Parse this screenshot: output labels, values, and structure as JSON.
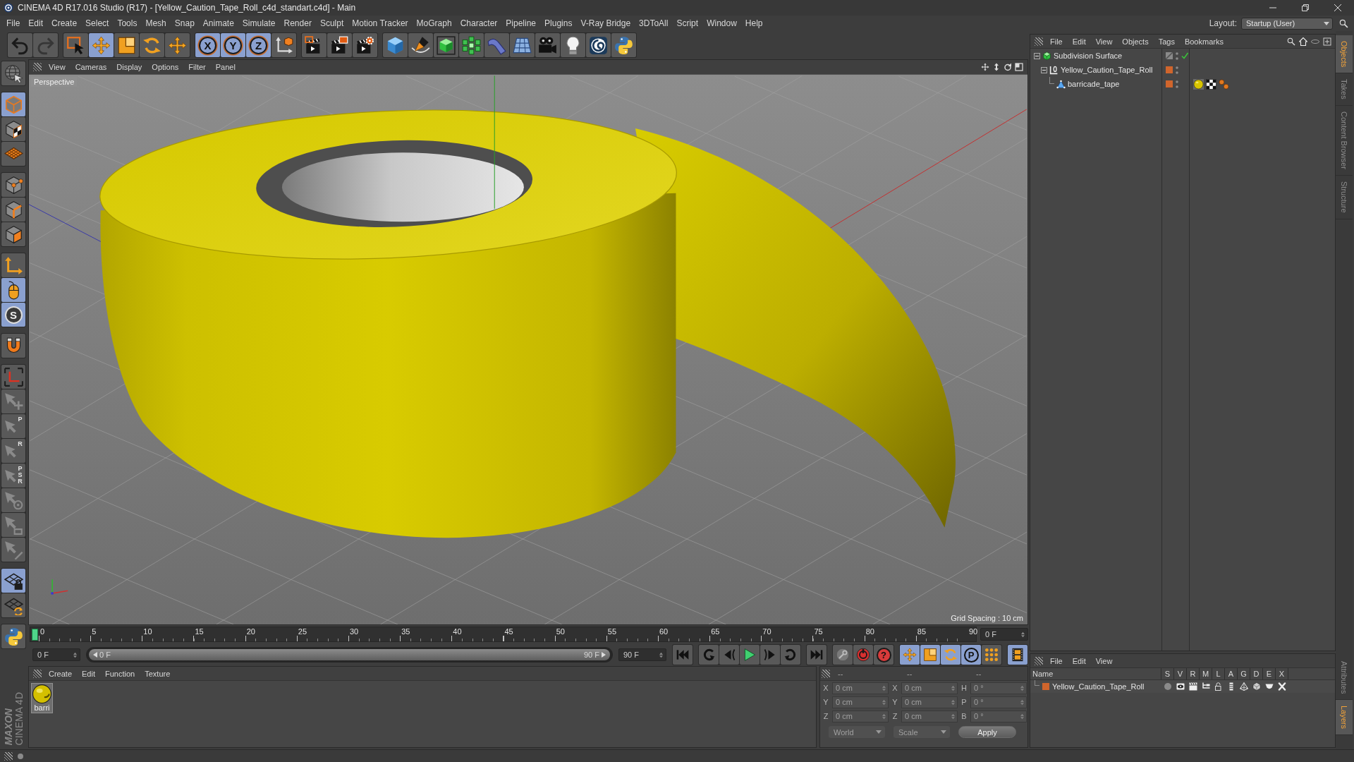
{
  "window": {
    "title": "CINEMA 4D R17.016 Studio (R17) - [Yellow_Caution_Tape_Roll_c4d_standart.c4d] - Main"
  },
  "menu_bar": [
    "File",
    "Edit",
    "Create",
    "Select",
    "Tools",
    "Mesh",
    "Snap",
    "Animate",
    "Simulate",
    "Render",
    "Sculpt",
    "Motion Tracker",
    "MoGraph",
    "Character",
    "Pipeline",
    "Plugins",
    "V-Ray Bridge",
    "3DToAll",
    "Script",
    "Window",
    "Help"
  ],
  "layout": {
    "label": "Layout:",
    "value": "Startup (User)"
  },
  "toolbar": [
    [
      {
        "selected": false,
        "disabled": false
      },
      {
        "selected": false,
        "disabled": true
      }
    ],
    [
      {
        "selected": false,
        "disabled": false
      },
      {
        "selected": true,
        "disabled": false
      },
      {
        "selected": false,
        "disabled": false
      },
      {
        "selected": false,
        "disabled": false
      },
      {
        "selected": false,
        "disabled": false
      }
    ],
    [
      {
        "label": "X",
        "selected": true,
        "disabled": false
      },
      {
        "label": "Y",
        "selected": true,
        "disabled": false
      },
      {
        "label": "Z",
        "selected": true,
        "disabled": false
      },
      {
        "selected": false,
        "disabled": false
      }
    ],
    [
      {
        "selected": false,
        "disabled": false
      },
      {
        "selected": false,
        "disabled": false
      },
      {
        "selected": false,
        "disabled": false
      }
    ],
    [
      {
        "selected": false,
        "disabled": false
      },
      {
        "selected": false,
        "disabled": false
      },
      {
        "selected": false,
        "disabled": false
      },
      {
        "selected": false,
        "disabled": false
      },
      {
        "selected": false,
        "disabled": false
      },
      {
        "selected": false,
        "disabled": false
      },
      {
        "selected": false,
        "disabled": false
      },
      {
        "selected": false,
        "disabled": false
      },
      {
        "selected": false,
        "disabled": false
      },
      {
        "selected": false,
        "disabled": false
      }
    ]
  ],
  "tools": [
    [
      {
        "selected": false,
        "disabled": false
      }
    ],
    [
      {
        "selected": true,
        "disabled": false
      },
      {
        "selected": false,
        "disabled": false
      },
      {
        "selected": false,
        "disabled": false
      }
    ],
    [
      {
        "selected": false,
        "disabled": false
      },
      {
        "selected": false,
        "disabled": false
      },
      {
        "selected": false,
        "disabled": false
      }
    ],
    [
      {
        "selected": false,
        "disabled": false
      },
      {
        "selected": true,
        "disabled": false
      },
      {
        "label": "S",
        "selected": true,
        "disabled": false
      }
    ],
    [
      {
        "selected": false,
        "disabled": false
      }
    ],
    [
      {
        "selected": false,
        "disabled": false
      },
      {
        "selected": false,
        "disabled": true
      },
      {
        "label": "P",
        "selected": false,
        "disabled": true
      },
      {
        "label": "R",
        "selected": false,
        "disabled": true
      },
      {
        "label": "PSR",
        "selected": false,
        "disabled": true
      },
      {
        "selected": false,
        "disabled": true
      },
      {
        "selected": false,
        "disabled": true
      },
      {
        "selected": false,
        "disabled": true
      }
    ],
    [
      {
        "selected": true,
        "disabled": false
      },
      {
        "selected": false,
        "disabled": false
      }
    ],
    [
      {
        "selected": false,
        "disabled": false
      }
    ]
  ],
  "viewport": {
    "menu": [
      "View",
      "Cameras",
      "Display",
      "Options",
      "Filter",
      "Panel"
    ],
    "camera": "Perspective",
    "grid_spacing": "Grid Spacing : 10 cm"
  },
  "timeline": {
    "ticks": [
      "0",
      "5",
      "10",
      "15",
      "20",
      "25",
      "30",
      "35",
      "40",
      "45",
      "50",
      "55",
      "60",
      "65",
      "70",
      "75",
      "80",
      "85",
      "90"
    ],
    "level": 0,
    "frame": "0 F"
  },
  "frame_range": {
    "start": "0 F",
    "slider_start": "0 F",
    "slider_end": "90 F",
    "level": 1,
    "end": "90 F"
  },
  "transport": [
    [
      {
        "selected": false
      }
    ],
    [
      {
        "selected": false
      },
      {
        "selected": false
      },
      {
        "selected": false
      },
      {
        "selected": false
      },
      {
        "selected": false
      }
    ],
    [
      {
        "selected": false
      }
    ],
    [
      {
        "selected": false
      },
      {
        "selected": false
      },
      {
        "label": "?",
        "selected": false
      }
    ],
    [
      {
        "selected": true
      },
      {
        "selected": true
      },
      {
        "selected": true
      },
      {
        "label": "P",
        "selected": true
      },
      {
        "selected": false
      }
    ],
    [
      {
        "selected": true
      }
    ]
  ],
  "materials": {
    "menu": [
      "Create",
      "Edit",
      "Function",
      "Texture"
    ],
    "items": [
      {
        "name": "barri"
      }
    ]
  },
  "coordinates": {
    "headers": [
      "--",
      "--",
      "--"
    ],
    "rows": [
      [
        {
          "axis": "X",
          "value": "0 cm",
          "disabled": true
        },
        {
          "axis": "X",
          "value": "0 cm",
          "disabled": true
        },
        {
          "axis": "H",
          "value": "0 °",
          "disabled": true
        }
      ],
      [
        {
          "axis": "Y",
          "value": "0 cm",
          "disabled": true
        },
        {
          "axis": "Y",
          "value": "0 cm",
          "disabled": true
        },
        {
          "axis": "P",
          "value": "0 °",
          "disabled": true
        }
      ],
      [
        {
          "axis": "Z",
          "value": "0 cm",
          "disabled": true
        },
        {
          "axis": "Z",
          "value": "0 cm",
          "disabled": true
        },
        {
          "axis": "B",
          "value": "0 °",
          "disabled": true
        }
      ]
    ],
    "modes": [
      {
        "label": "World",
        "disabled": true
      },
      {
        "label": "Scale",
        "disabled": true
      }
    ],
    "apply": "Apply"
  },
  "objects": {
    "menu": [
      "File",
      "Edit",
      "View",
      "Objects",
      "Tags",
      "Bookmarks"
    ],
    "tree": [
      {
        "kind": "subdivision",
        "name": "Subdivision Surface",
        "expanded": true,
        "enabled": true,
        "children": [
          {
            "kind": "null",
            "name": "Yellow_Caution_Tape_Roll",
            "color": "#d0652c",
            "expanded": true,
            "children": [
              {
                "kind": "polygon",
                "name": "barricade_tape",
                "color": "#d0652c",
                "tags": [
                  {
                    "kind": "material"
                  },
                  {
                    "kind": "texture"
                  },
                  {
                    "kind": "dots"
                  }
                ]
              }
            ]
          }
        ]
      }
    ]
  },
  "layers": {
    "menu": [
      "File",
      "Edit",
      "View"
    ],
    "columns": [
      "Name",
      "S",
      "V",
      "R",
      "M",
      "L",
      "A",
      "G",
      "D",
      "E",
      "X"
    ],
    "rows": [
      {
        "name": "Yellow_Caution_Tape_Roll",
        "color": "#d0652c"
      }
    ]
  },
  "side_tabs": {
    "top": [
      {
        "label": "Objects",
        "selected": true
      },
      {
        "label": "Takes",
        "selected": false
      },
      {
        "label": "Content Browser",
        "selected": false
      },
      {
        "label": "Structure",
        "selected": false
      }
    ],
    "bottom": [
      {
        "label": "Attributes",
        "selected": false
      },
      {
        "label": "Layers",
        "selected": true
      }
    ]
  },
  "logo": {
    "brand": "MAXON",
    "product": "CINEMA 4D"
  }
}
